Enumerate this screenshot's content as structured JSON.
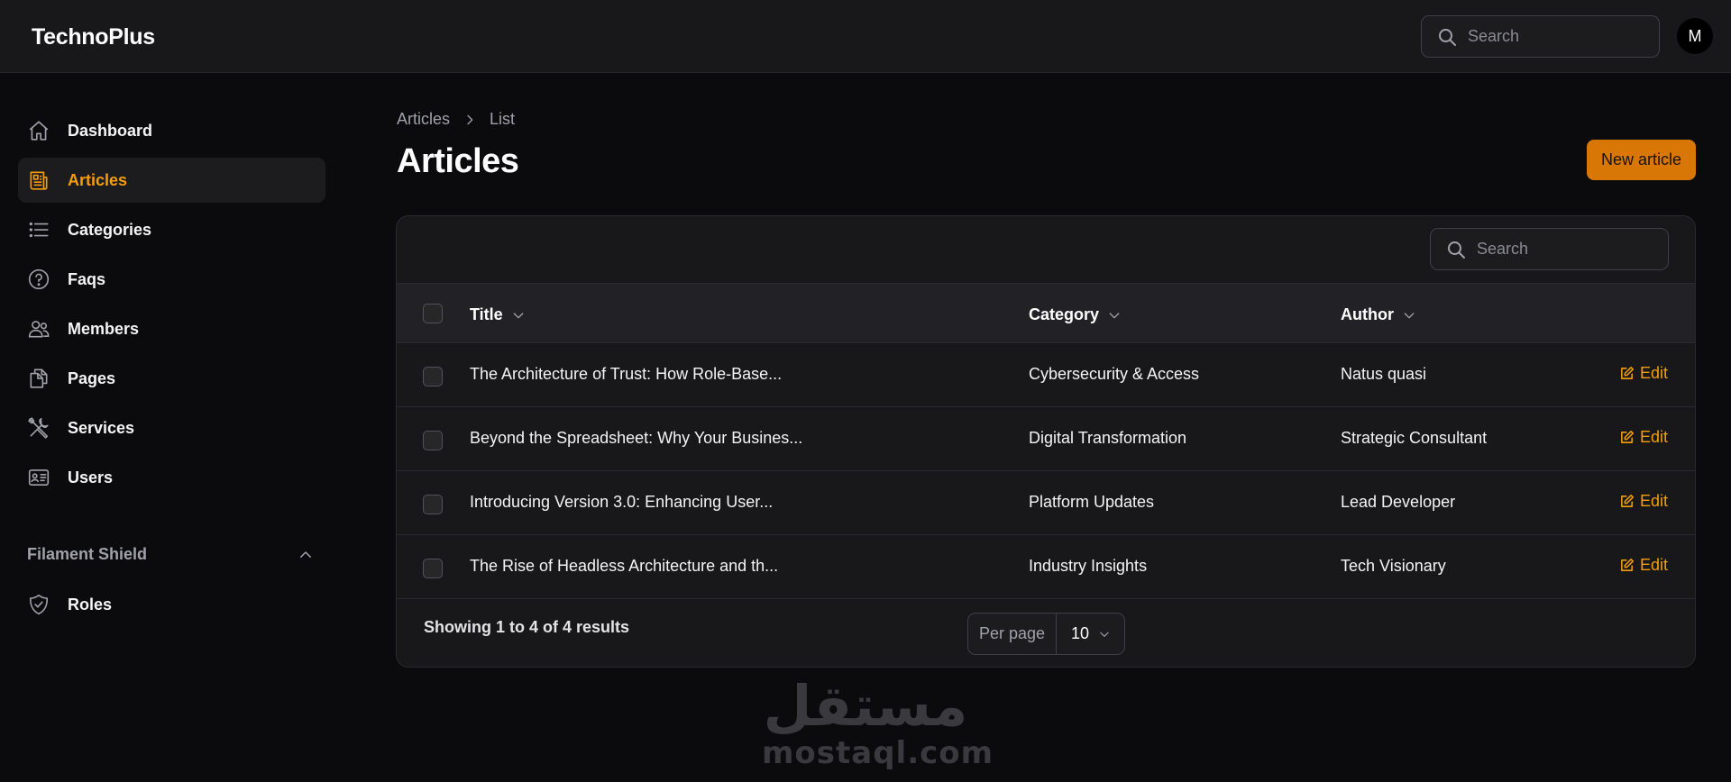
{
  "app": {
    "brand": "TechnoPlus",
    "avatar_initial": "M"
  },
  "topbar": {
    "search_placeholder": "Search"
  },
  "sidebar": {
    "items": [
      {
        "label": "Dashboard",
        "icon": "home-icon",
        "active": false
      },
      {
        "label": "Articles",
        "icon": "newspaper-icon",
        "active": true
      },
      {
        "label": "Categories",
        "icon": "list-icon",
        "active": false
      },
      {
        "label": "Faqs",
        "icon": "question-circle-icon",
        "active": false
      },
      {
        "label": "Members",
        "icon": "users-icon",
        "active": false
      },
      {
        "label": "Pages",
        "icon": "documents-icon",
        "active": false
      },
      {
        "label": "Services",
        "icon": "wrench-screwdriver-icon",
        "active": false
      },
      {
        "label": "Users",
        "icon": "identification-icon",
        "active": false
      }
    ],
    "group": {
      "label": "Filament Shield",
      "items": [
        {
          "label": "Roles",
          "icon": "shield-check-icon"
        }
      ]
    }
  },
  "breadcrumb": {
    "items": [
      "Articles",
      "List"
    ]
  },
  "page": {
    "title": "Articles",
    "new_button": "New article"
  },
  "table": {
    "search_placeholder": "Search",
    "columns": [
      "Title",
      "Category",
      "Author"
    ],
    "rows": [
      {
        "title": "The Architecture of Trust: How Role-Base...",
        "category": "Cybersecurity & Access",
        "author": "Natus quasi",
        "action": "Edit"
      },
      {
        "title": "Beyond the Spreadsheet: Why Your Busines...",
        "category": "Digital Transformation",
        "author": "Strategic Consultant",
        "action": "Edit"
      },
      {
        "title": "Introducing Version 3.0: Enhancing User...",
        "category": "Platform Updates",
        "author": "Lead Developer",
        "action": "Edit"
      },
      {
        "title": "The Rise of Headless Architecture and th...",
        "category": "Industry Insights",
        "author": "Tech Visionary",
        "action": "Edit"
      }
    ],
    "footer": {
      "summary": "Showing 1 to 4 of 4 results",
      "per_page_label": "Per page",
      "per_page_value": "10"
    }
  },
  "watermark": {
    "arabic": "مستقل",
    "latin": "mostaql.com"
  },
  "colors": {
    "accent": "#f59e0b",
    "button": "#d97706",
    "background": "#0b0b0d",
    "surface": "#18181b"
  }
}
